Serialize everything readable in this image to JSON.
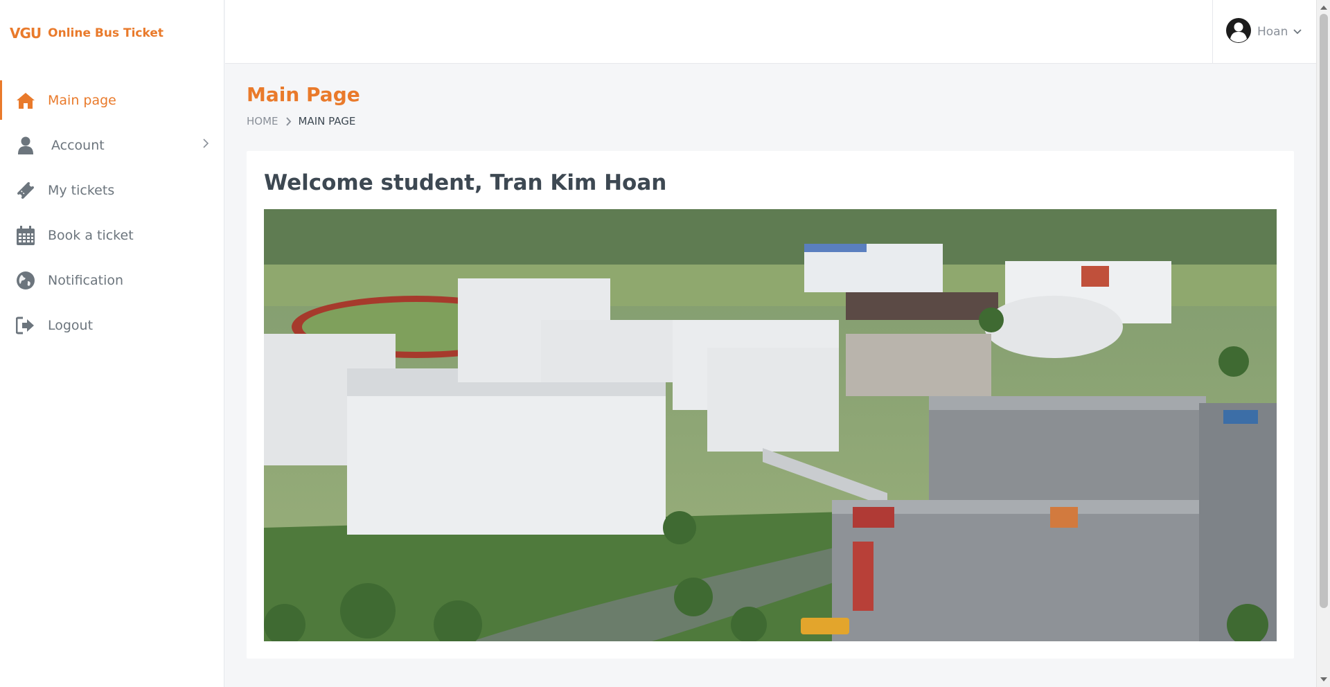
{
  "app": {
    "logo_mark": "VGU",
    "logo_text": "Online Bus Ticket"
  },
  "sidebar": {
    "items": [
      {
        "label": "Main page",
        "icon": "home-icon",
        "active": true
      },
      {
        "label": "Account",
        "icon": "user-icon",
        "active": false,
        "has_submenu": true
      },
      {
        "label": "My tickets",
        "icon": "ticket-icon",
        "active": false
      },
      {
        "label": "Book a ticket",
        "icon": "calendar-icon",
        "active": false
      },
      {
        "label": "Notification",
        "icon": "globe-icon",
        "active": false
      },
      {
        "label": "Logout",
        "icon": "logout-icon",
        "active": false
      }
    ]
  },
  "header": {
    "user_name": "Hoan",
    "user_icon": "user-circle-icon"
  },
  "main": {
    "page_title": "Main Page",
    "breadcrumb": {
      "home": "HOME",
      "current": "MAIN PAGE"
    },
    "welcome": "Welcome student, Tran Kim Hoan",
    "hero_image": "aerial-campus-photo"
  },
  "colors": {
    "accent": "#e97a2b",
    "muted_text": "#6c757d",
    "background": "#f5f6f8"
  }
}
